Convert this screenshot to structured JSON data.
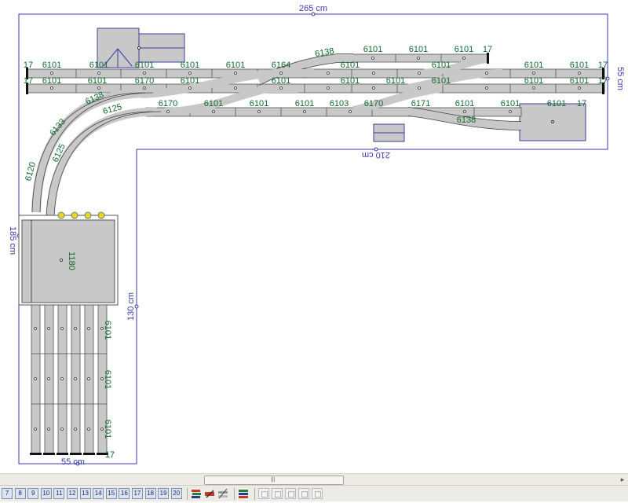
{
  "dimensions": {
    "top_width": "265 cm",
    "right_depth": "55 cm",
    "inner_width": "210 cm",
    "left_depth": "185 cm",
    "inner_depth": "130 cm",
    "bottom_width": "55 cm"
  },
  "track_labels": {
    "row1": [
      "17",
      "6101",
      "6101",
      "6101",
      "6101",
      "6101",
      "6164",
      "6101",
      "6101",
      "6101",
      "6101",
      "17"
    ],
    "row1b": [
      "6138",
      "6101",
      "6101",
      "6101",
      "17"
    ],
    "row2": [
      "17",
      "6101",
      "6101",
      "6170",
      "6101",
      "6101",
      "6101",
      "6101",
      "6101",
      "6101",
      "6101",
      "17"
    ],
    "row3": [
      "6170",
      "6101",
      "6101",
      "6101",
      "6103",
      "6170",
      "6171",
      "6101",
      "6101",
      "6101",
      "17"
    ],
    "curves": [
      "6138",
      "6125",
      "6133",
      "6125",
      "6120",
      "6138"
    ],
    "turntable": "1180",
    "verticals": [
      "6101",
      "6101",
      "6101"
    ],
    "vertical_end": "17"
  },
  "toolbar": {
    "layers": [
      "7",
      "8",
      "9",
      "10",
      "11",
      "12",
      "13",
      "14",
      "15",
      "16",
      "17",
      "18",
      "19",
      "20"
    ]
  },
  "colors": {
    "dimension": "#3a3ab0",
    "label": "#0e6b2e",
    "track": "#c8c8c8",
    "building": "#c8c8c8",
    "building_border": "#3c3ca0"
  }
}
